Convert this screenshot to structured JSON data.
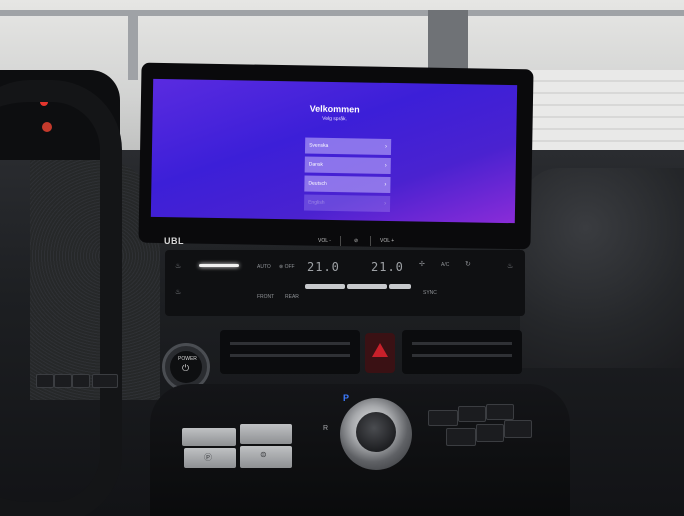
{
  "screen": {
    "title": "Velkommen",
    "subtitle": "Velg språk.",
    "languages": [
      {
        "label": "Svenska"
      },
      {
        "label": "Dansk"
      },
      {
        "label": "Deutsch"
      },
      {
        "label": "English"
      }
    ]
  },
  "bezel": {
    "brand": "UBL",
    "vol_minus": "VOL -",
    "vol_plus": "VOL +",
    "mute": "⊘"
  },
  "climate": {
    "auto": "AUTO",
    "off": "⊗ OFF",
    "temp_left": "21.0",
    "temp_right": "21.0",
    "ac": "A/C",
    "front": "FRONT",
    "rear": "REAR",
    "sync": "SYNC"
  },
  "power": {
    "label": "POWER",
    "icon": "⏻"
  },
  "shifter": {
    "p": "P",
    "r": "R"
  },
  "colors": {
    "screen_top": "#5a2be0",
    "screen_bottom": "#8a2cd8",
    "hazard": "#c8202a",
    "park_indicator": "#3d7bff"
  }
}
